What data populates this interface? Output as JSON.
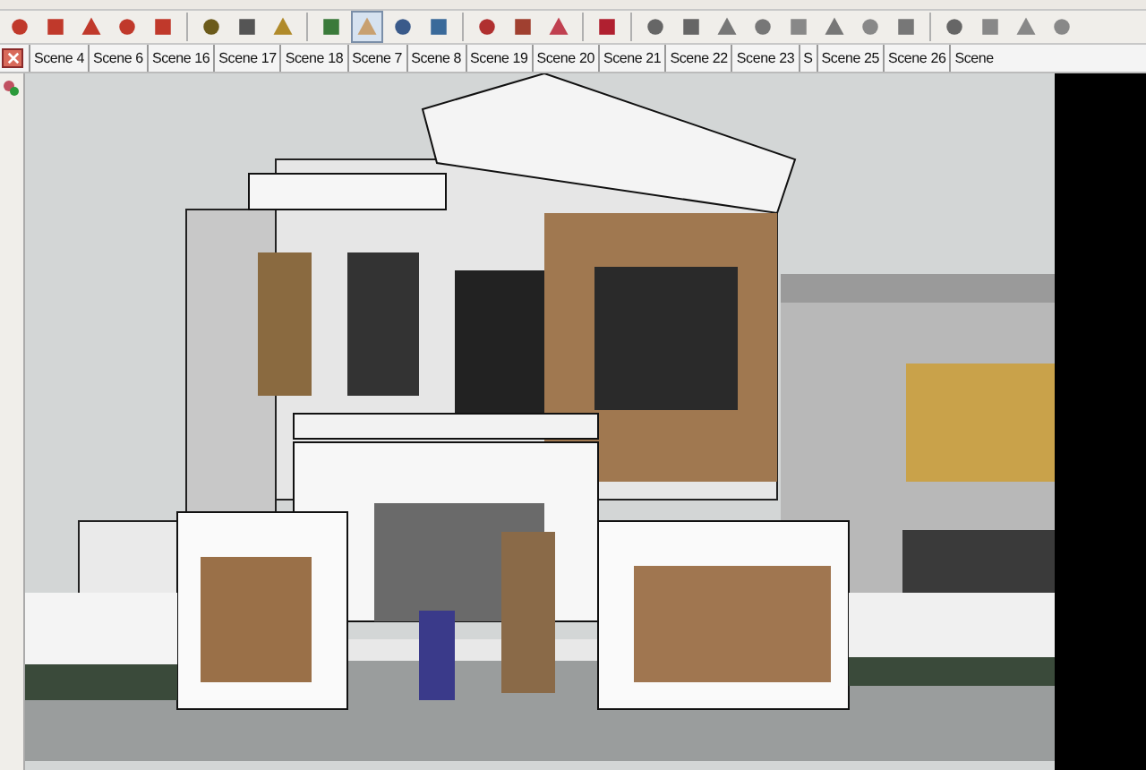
{
  "scene_tabs": [
    {
      "label": "Scene 4"
    },
    {
      "label": "Scene 6"
    },
    {
      "label": "Scene 16"
    },
    {
      "label": "Scene 17"
    },
    {
      "label": "Scene 18"
    },
    {
      "label": "Scene 7"
    },
    {
      "label": "Scene 8"
    },
    {
      "label": "Scene 19"
    },
    {
      "label": "Scene 20"
    },
    {
      "label": "Scene 21"
    },
    {
      "label": "Scene 22"
    },
    {
      "label": "Scene 23"
    },
    {
      "label": "S"
    },
    {
      "label": "Scene 25"
    },
    {
      "label": "Scene 26"
    },
    {
      "label": "Scene"
    }
  ]
}
